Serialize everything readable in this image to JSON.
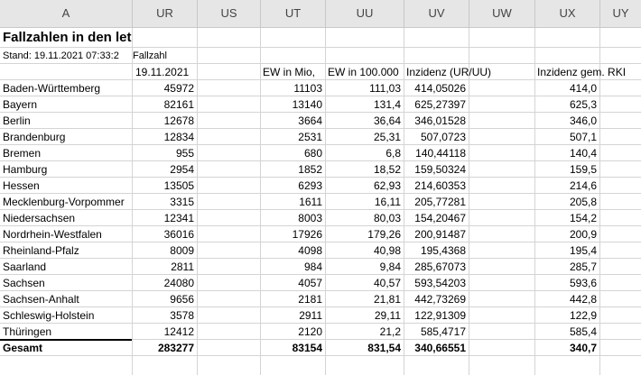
{
  "columns": [
    "A",
    "UR",
    "US",
    "UT",
    "UU",
    "UV",
    "UW",
    "UX",
    "UY"
  ],
  "title": "Fallzahlen in den let",
  "stand": "Stand: 19.11.2021 07:33:2",
  "fallzahl": "Fallzahl",
  "headers": {
    "ur": "19.11.2021",
    "ut": "EW in Mio,",
    "uu": "EW in 100.000",
    "uv": "Inzidenz (UR/UU)",
    "ux": "Inzidenz gem. RKI"
  },
  "rows": [
    {
      "name": "Baden-Württemberg",
      "ur": "45972",
      "ut": "11103",
      "uu": "111,03",
      "uv": "414,05026",
      "ux": "414,0"
    },
    {
      "name": "Bayern",
      "ur": "82161",
      "ut": "13140",
      "uu": "131,4",
      "uv": "625,27397",
      "ux": "625,3"
    },
    {
      "name": "Berlin",
      "ur": "12678",
      "ut": "3664",
      "uu": "36,64",
      "uv": "346,01528",
      "ux": "346,0"
    },
    {
      "name": "Brandenburg",
      "ur": "12834",
      "ut": "2531",
      "uu": "25,31",
      "uv": "507,0723",
      "ux": "507,1"
    },
    {
      "name": "Bremen",
      "ur": "955",
      "ut": "680",
      "uu": "6,8",
      "uv": "140,44118",
      "ux": "140,4"
    },
    {
      "name": "Hamburg",
      "ur": "2954",
      "ut": "1852",
      "uu": "18,52",
      "uv": "159,50324",
      "ux": "159,5"
    },
    {
      "name": "Hessen",
      "ur": "13505",
      "ut": "6293",
      "uu": "62,93",
      "uv": "214,60353",
      "ux": "214,6"
    },
    {
      "name": "Mecklenburg-Vorpommer",
      "ur": "3315",
      "ut": "1611",
      "uu": "16,11",
      "uv": "205,77281",
      "ux": "205,8"
    },
    {
      "name": "Niedersachsen",
      "ur": "12341",
      "ut": "8003",
      "uu": "80,03",
      "uv": "154,20467",
      "ux": "154,2"
    },
    {
      "name": "Nordrhein-Westfalen",
      "ur": "36016",
      "ut": "17926",
      "uu": "179,26",
      "uv": "200,91487",
      "ux": "200,9"
    },
    {
      "name": "Rheinland-Pfalz",
      "ur": "8009",
      "ut": "4098",
      "uu": "40,98",
      "uv": "195,4368",
      "ux": "195,4"
    },
    {
      "name": "Saarland",
      "ur": "2811",
      "ut": "984",
      "uu": "9,84",
      "uv": "285,67073",
      "ux": "285,7"
    },
    {
      "name": "Sachsen",
      "ur": "24080",
      "ut": "4057",
      "uu": "40,57",
      "uv": "593,54203",
      "ux": "593,6"
    },
    {
      "name": "Sachsen-Anhalt",
      "ur": "9656",
      "ut": "2181",
      "uu": "21,81",
      "uv": "442,73269",
      "ux": "442,8"
    },
    {
      "name": "Schleswig-Holstein",
      "ur": "3578",
      "ut": "2911",
      "uu": "29,11",
      "uv": "122,91309",
      "ux": "122,9"
    },
    {
      "name": "Thüringen",
      "ur": "12412",
      "ut": "2120",
      "uu": "21,2",
      "uv": "585,4717",
      "ux": "585,4"
    }
  ],
  "total": {
    "name": "Gesamt",
    "ur": "283277",
    "ut": "83154",
    "uu": "831,54",
    "uv": "340,66551",
    "ux": "340,7"
  }
}
